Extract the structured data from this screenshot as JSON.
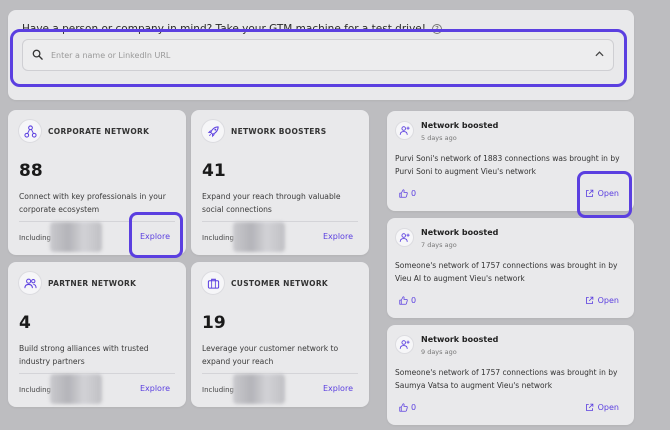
{
  "search": {
    "prompt": "Have a person or company in mind? Take your GTM machine for a test drive!",
    "help_glyph": "?",
    "placeholder": "Enter a name or LinkedIn URL",
    "value": ""
  },
  "cards": [
    {
      "title": "CORPORATE NETWORK",
      "icon": "network-nodes-icon",
      "count": "88",
      "description": "Connect with key professionals in your corporate ecosystem",
      "including_label": "Including",
      "explore_label": "Explore"
    },
    {
      "title": "NETWORK BOOSTERS",
      "icon": "rocket-icon",
      "count": "41",
      "description": "Expand your reach through valuable social connections",
      "including_label": "Including",
      "explore_label": "Explore"
    },
    {
      "title": "PARTNER NETWORK",
      "icon": "users-icon",
      "count": "4",
      "description": "Build strong alliances with trusted industry partners",
      "including_label": "Including",
      "explore_label": "Explore"
    },
    {
      "title": "CUSTOMER NETWORK",
      "icon": "briefcase-icon",
      "count": "19",
      "description": "Leverage your customer network to expand your reach",
      "including_label": "Including",
      "explore_label": "Explore"
    }
  ],
  "feed": [
    {
      "title": "Network boosted",
      "time": "5 days ago",
      "text": "Purvi Soni's network of 1883 connections was brought in by Purvi Soni to augment Vieu's network",
      "likes": "0",
      "open_label": "Open"
    },
    {
      "title": "Network boosted",
      "time": "7 days ago",
      "text": "Someone's network of 1757 connections was brought in by Vieu AI to augment Vieu's network",
      "likes": "0",
      "open_label": "Open"
    },
    {
      "title": "Network boosted",
      "time": "9 days ago",
      "text": "Someone's network of 1757 connections was brought in by Saumya Vatsa to augment Vieu's network",
      "likes": "0",
      "open_label": "Open"
    }
  ],
  "colors": {
    "accent": "#5b3fe0",
    "background": "#bdbdc0",
    "panel": "#e9e9eb"
  }
}
